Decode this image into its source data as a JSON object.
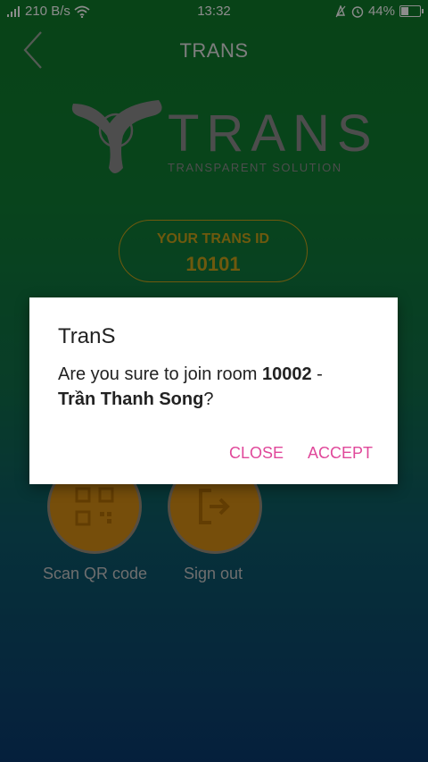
{
  "status_bar": {
    "network_speed": "210 B/s",
    "time": "13:32",
    "battery": "44%",
    "battery_level": 0.44,
    "icons": [
      "signal-icon",
      "wifi-icon",
      "alarm-icon",
      "clock-icon",
      "battery-icon"
    ]
  },
  "header": {
    "title": "TRANS",
    "back_icon": "back-chevron-icon"
  },
  "logo": {
    "wordmark": "TRANS",
    "tagline": "TRANSPARENT SOLUTION"
  },
  "trans_id": {
    "label": "YOUR TRANS ID",
    "value": "10101"
  },
  "actions": [
    {
      "label": "Scan QR code",
      "icon": "qr-code-icon"
    },
    {
      "label": "Sign out",
      "icon": "sign-out-icon"
    }
  ],
  "dialog": {
    "title": "TranS",
    "message_prefix": "Are you sure to join room ",
    "room_id": "10002",
    "separator": " -",
    "room_name": "Trần Thanh Song",
    "message_suffix": "?",
    "close_label": "CLOSE",
    "accept_label": "ACCEPT"
  },
  "colors": {
    "accent_gold": "#c9a21a",
    "button_orange": "#d88f14",
    "dialog_action_pink": "#e0489a"
  }
}
